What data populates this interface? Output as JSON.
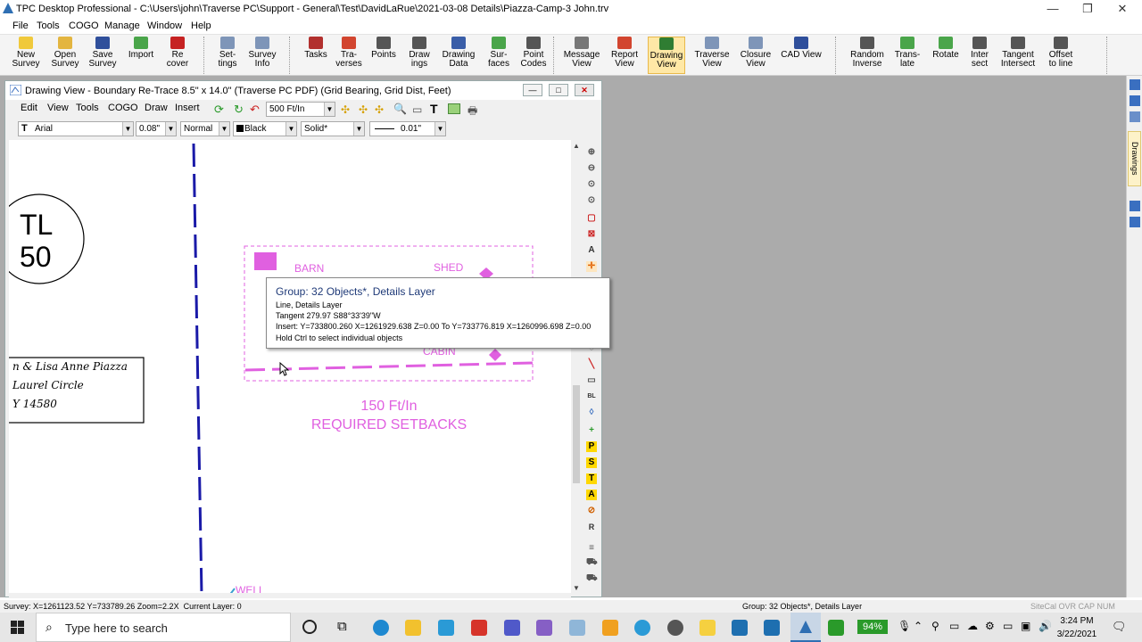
{
  "window": {
    "title": "TPC Desktop Professional - C:\\Users\\john\\Traverse PC\\Support - General\\Test\\DavidLaRue\\2021-03-08 Details\\Piazza-Camp-3 John.trv",
    "minimize": "—",
    "restore": "❐",
    "close": "✕"
  },
  "menu": [
    "File",
    "Tools",
    "COGO",
    "Manage",
    "Window",
    "Help"
  ],
  "ribbon": [
    {
      "l1": "New",
      "l2": "Survey",
      "icon": "new-file-icon",
      "color": "#f0c93b"
    },
    {
      "l1": "Open",
      "l2": "Survey",
      "icon": "open-folder-icon",
      "color": "#e3b540"
    },
    {
      "l1": "Save",
      "l2": "Survey",
      "icon": "save-disk-icon",
      "color": "#2f4f9b"
    },
    {
      "l1": "Import",
      "l2": "",
      "icon": "import-icon",
      "color": "#4aa54a"
    },
    {
      "l1": "Re",
      "l2": "cover",
      "icon": "recover-icon",
      "color": "#c62222"
    },
    {
      "l1": "Set-",
      "l2": "tings",
      "icon": "settings-icon",
      "color": "#7e95b8"
    },
    {
      "l1": "Survey",
      "l2": "Info",
      "icon": "survey-info-icon",
      "color": "#7e95b8"
    },
    {
      "l1": "Tasks",
      "l2": "",
      "icon": "tasks-icon",
      "color": "#b2302e"
    },
    {
      "l1": "Tra-",
      "l2": "verses",
      "icon": "traverses-icon",
      "color": "#d2452f"
    },
    {
      "l1": "Points",
      "l2": "",
      "icon": "points-icon",
      "color": "#555"
    },
    {
      "l1": "Draw",
      "l2": "ings",
      "icon": "drawings-icon",
      "color": "#555"
    },
    {
      "l1": "Drawing",
      "l2": "Data",
      "icon": "drawing-data-icon",
      "color": "#3a5ea8"
    },
    {
      "l1": "Sur-",
      "l2": "faces",
      "icon": "surfaces-icon",
      "color": "#4aa54a"
    },
    {
      "l1": "Point",
      "l2": "Codes",
      "icon": "point-codes-icon",
      "color": "#555"
    },
    {
      "l1": "Message",
      "l2": "View",
      "icon": "message-view-icon",
      "color": "#777"
    },
    {
      "l1": "Report",
      "l2": "View",
      "icon": "report-view-icon",
      "color": "#d2452f"
    },
    {
      "l1": "Drawing",
      "l2": "View",
      "icon": "drawing-view-icon",
      "color": "#2f7d32"
    },
    {
      "l1": "Traverse",
      "l2": "View",
      "icon": "traverse-view-icon",
      "color": "#7e95b8"
    },
    {
      "l1": "Closure",
      "l2": "View",
      "icon": "closure-view-icon",
      "color": "#7e95b8"
    },
    {
      "l1": "CAD View",
      "l2": "",
      "icon": "cad-view-icon",
      "color": "#2f4f9b"
    },
    {
      "l1": "Random",
      "l2": "Inverse",
      "icon": "random-inverse-icon",
      "color": "#555"
    },
    {
      "l1": "Trans-",
      "l2": "late",
      "icon": "translate-icon",
      "color": "#4aa54a"
    },
    {
      "l1": "Rotate",
      "l2": "",
      "icon": "rotate-icon",
      "color": "#4aa54a"
    },
    {
      "l1": "Inter",
      "l2": "sect",
      "icon": "intersect-icon",
      "color": "#555"
    },
    {
      "l1": "Tangent",
      "l2": "Intersect",
      "icon": "tangent-intersect-icon",
      "color": "#555"
    },
    {
      "l1": "Offset",
      "l2": "to line",
      "icon": "offset-line-icon",
      "color": "#555"
    }
  ],
  "drawing_window": {
    "title": "Drawing View - Boundary Re-Trace 8.5\" x 14.0\" (Traverse PC PDF) (Grid Bearing, Grid Dist, Feet)",
    "menu": [
      "Edit",
      "View",
      "Tools",
      "COGO",
      "Draw",
      "Insert"
    ],
    "scale": "500 Ft/In",
    "font": "Arial",
    "text_size": "0.08\"",
    "style": "Normal",
    "color_name": "Black",
    "linetype": "Solid*",
    "line_width": "0.01\""
  },
  "drawing": {
    "tl_top": "TL",
    "tl_bottom": "50",
    "owner_line1": "n & Lisa Anne Piazza",
    "owner_line2": "Laurel Circle",
    "owner_line3": "Y 14580",
    "barn": "BARN",
    "shed": "SHED",
    "cabin": "CABIN",
    "setback_scale": "150 Ft/In",
    "setback_title": "REQUIRED SETBACKS",
    "well": "WELL",
    "magenta": "#e060e0",
    "blue": "#1a1aa8"
  },
  "tooltip": {
    "header": "Group: 32 Objects*, Details Layer",
    "line1": "Line, Details Layer",
    "line2": "Tangent 279.97 S88°33'39\"W",
    "line3": "Insert: Y=733800.260 X=1261929.638 Z=0.00 To Y=733776.819 X=1260996.698 Z=0.00",
    "line4": "Hold Ctrl to select individual objects"
  },
  "status": {
    "left": "Survey: X=1261123.52 Y=733789.26 Zoom=2.2X  Current Layer: 0",
    "mid": "Group: 32 Objects*, Details Layer",
    "right": "SiteCal OVR CAP NUM"
  },
  "dock_tab": "Drawings",
  "taskbar": {
    "search_placeholder": "Type here to search",
    "battery": "94%",
    "time": "3:24 PM",
    "date": "3/22/2021"
  }
}
